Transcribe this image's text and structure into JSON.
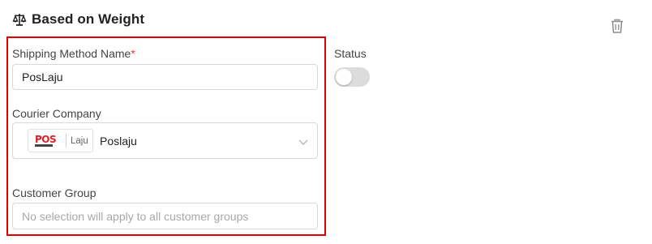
{
  "header": {
    "title": "Based on Weight",
    "icon": "weight-scale-icon"
  },
  "actions": {
    "delete_icon": "trash-icon"
  },
  "shipping_method": {
    "label": "Shipping Method Name",
    "required_mark": "*",
    "value": "PosLaju"
  },
  "courier": {
    "label": "Courier Company",
    "selected": "Poslaju",
    "logo_sub": "Laju",
    "logo_icon": "poslaju-logo"
  },
  "customer_group": {
    "label": "Customer Group",
    "placeholder": "No selection will apply to all customer groups"
  },
  "status": {
    "label": "Status",
    "enabled": false
  },
  "colors": {
    "highlight": "#e00000",
    "required": "#e53935",
    "logo_red": "#d8232a"
  }
}
